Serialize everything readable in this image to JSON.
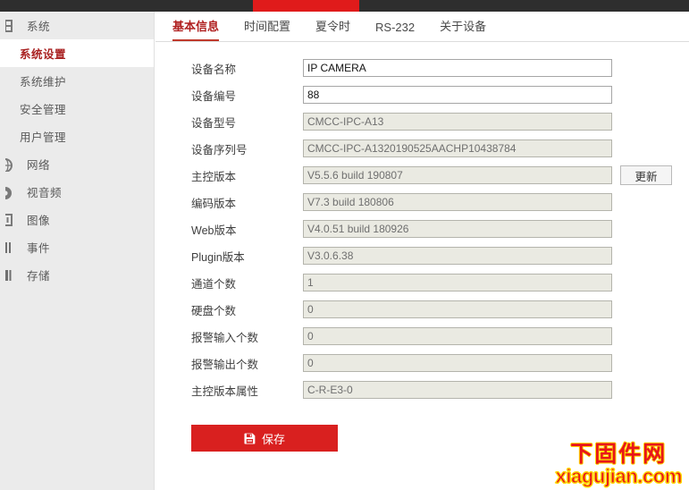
{
  "topbar": {
    "accent_color": "#e01b1b",
    "bar_color": "#2e2e2e"
  },
  "sidebar": {
    "items": [
      {
        "label": "系统",
        "icon": "grid-icon",
        "active": false,
        "sub": false
      },
      {
        "label": "系统设置",
        "icon": "",
        "active": true,
        "sub": true
      },
      {
        "label": "系统维护",
        "icon": "",
        "active": false,
        "sub": true
      },
      {
        "label": "安全管理",
        "icon": "",
        "active": false,
        "sub": true
      },
      {
        "label": "用户管理",
        "icon": "",
        "active": false,
        "sub": true
      },
      {
        "label": "网络",
        "icon": "globe-icon",
        "active": false,
        "sub": false
      },
      {
        "label": "视音频",
        "icon": "speaker-icon",
        "active": false,
        "sub": false
      },
      {
        "label": "图像",
        "icon": "image-icon",
        "active": false,
        "sub": false
      },
      {
        "label": "事件",
        "icon": "event-icon",
        "active": false,
        "sub": false
      },
      {
        "label": "存储",
        "icon": "storage-icon",
        "active": false,
        "sub": false
      }
    ]
  },
  "tabs": [
    {
      "label": "基本信息",
      "active": true
    },
    {
      "label": "时间配置",
      "active": false
    },
    {
      "label": "夏令时",
      "active": false
    },
    {
      "label": "RS-232",
      "active": false
    },
    {
      "label": "关于设备",
      "active": false
    }
  ],
  "form": {
    "rows": [
      {
        "label": "设备名称",
        "value": "IP CAMERA",
        "readonly": false,
        "action": ""
      },
      {
        "label": "设备编号",
        "value": "88",
        "readonly": false,
        "action": ""
      },
      {
        "label": "设备型号",
        "value": "CMCC-IPC-A13",
        "readonly": true,
        "action": ""
      },
      {
        "label": "设备序列号",
        "value": "CMCC-IPC-A1320190525AACHP10438784",
        "readonly": true,
        "action": ""
      },
      {
        "label": "主控版本",
        "value": "V5.5.6 build 190807",
        "readonly": true,
        "action": "更新"
      },
      {
        "label": "编码版本",
        "value": "V7.3 build 180806",
        "readonly": true,
        "action": ""
      },
      {
        "label": "Web版本",
        "value": "V4.0.51 build 180926",
        "readonly": true,
        "action": ""
      },
      {
        "label": "Plugin版本",
        "value": "V3.0.6.38",
        "readonly": true,
        "action": ""
      },
      {
        "label": "通道个数",
        "value": "1",
        "readonly": true,
        "action": ""
      },
      {
        "label": "硬盘个数",
        "value": "0",
        "readonly": true,
        "action": ""
      },
      {
        "label": "报警输入个数",
        "value": "0",
        "readonly": true,
        "action": ""
      },
      {
        "label": "报警输出个数",
        "value": "0",
        "readonly": true,
        "action": ""
      },
      {
        "label": "主控版本属性",
        "value": "C-R-E3-0",
        "readonly": true,
        "action": ""
      }
    ],
    "save_label": "保存",
    "save_icon": "floppy-save-icon",
    "save_color": "#d9201f"
  },
  "watermark": {
    "line1": "下固件网",
    "line2": "xiagujian.com",
    "fill_color": "#e8161b",
    "stroke_color": "#ffd900"
  }
}
